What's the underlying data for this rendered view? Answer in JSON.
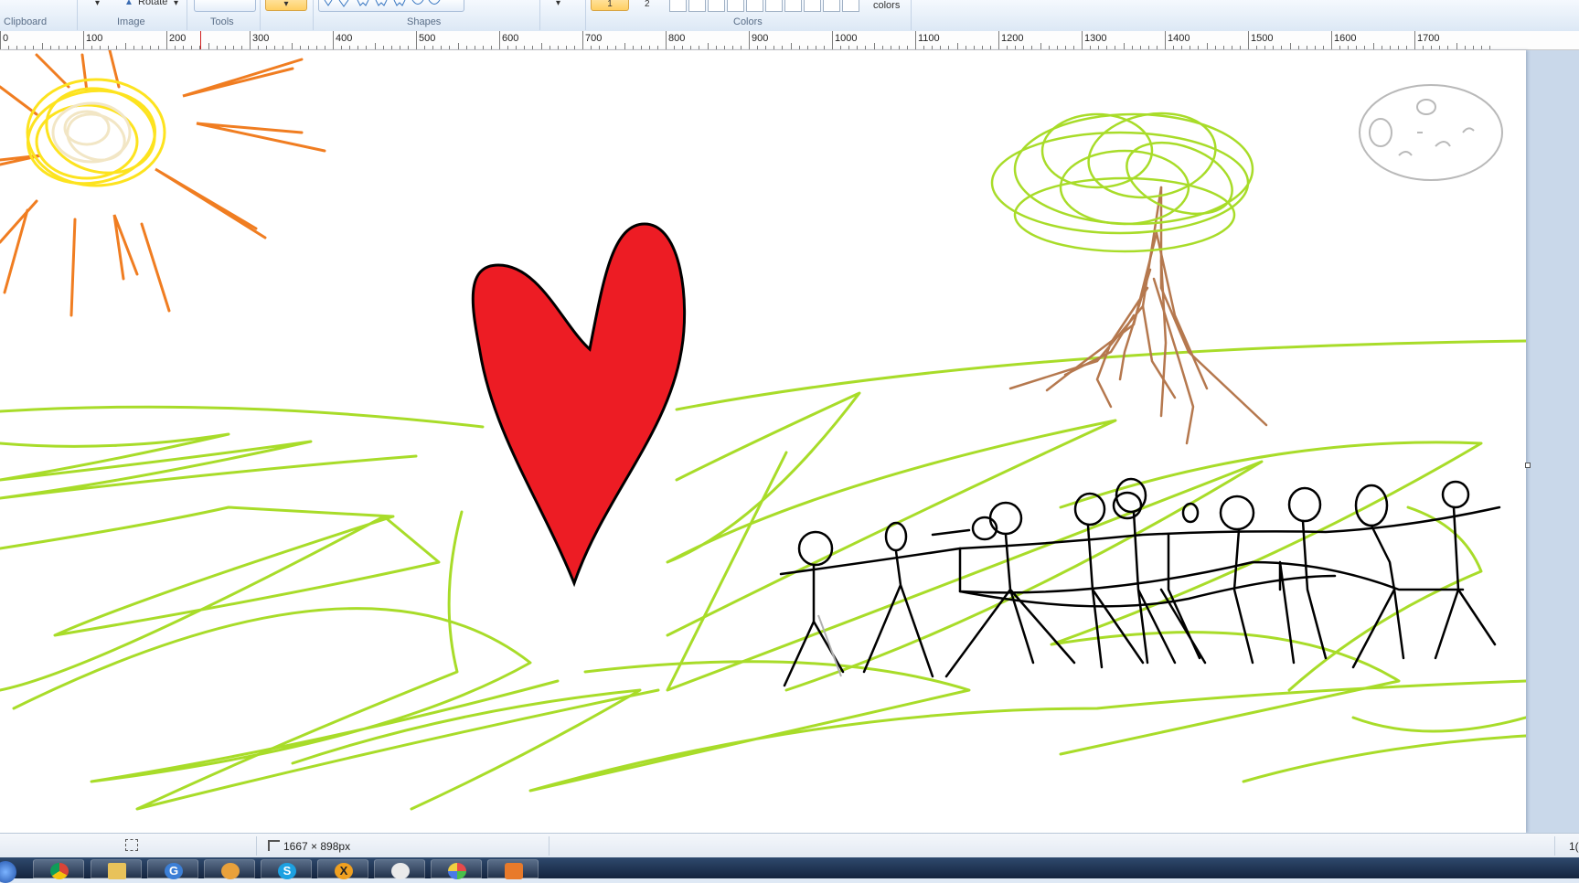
{
  "ribbon": {
    "groups": {
      "clipboard": "Clipboard",
      "image": "Image",
      "tools": "Tools",
      "shapes": "Shapes",
      "colors": "Colors"
    },
    "rotate_label": "Rotate",
    "color1_label": "1",
    "color2_label": "2",
    "edit_colors_label": "colors",
    "accent": "#ffcf63"
  },
  "ruler": {
    "labels": [
      "0",
      "100",
      "200",
      "300",
      "400",
      "500",
      "600",
      "700",
      "800",
      "900",
      "1000",
      "1100",
      "1200",
      "1300",
      "1400",
      "1500",
      "1600",
      "1700"
    ]
  },
  "canvas": {
    "background": "#ffffff",
    "colors": {
      "sun_rays": "#f07d21",
      "sun": "#fde31f",
      "sun_inner": "#f2e6c5",
      "heart_fill": "#ed1c24",
      "outline": "#000000",
      "grass": "#a8dc29",
      "tree_leaves": "#a8dc29",
      "tree_trunk": "#b5784e",
      "moon": "#b9b9b9"
    }
  },
  "status": {
    "image_size": "1667 × 898px",
    "right_edge": "1("
  },
  "taskbar": {
    "items": [
      "start-orb-icon",
      "chrome-icon",
      "explorer-icon",
      "search-icon",
      "winamp-icon",
      "skype-icon",
      "xmen-icon",
      "penguin-icon",
      "paint-icon",
      "media-player-icon"
    ]
  }
}
